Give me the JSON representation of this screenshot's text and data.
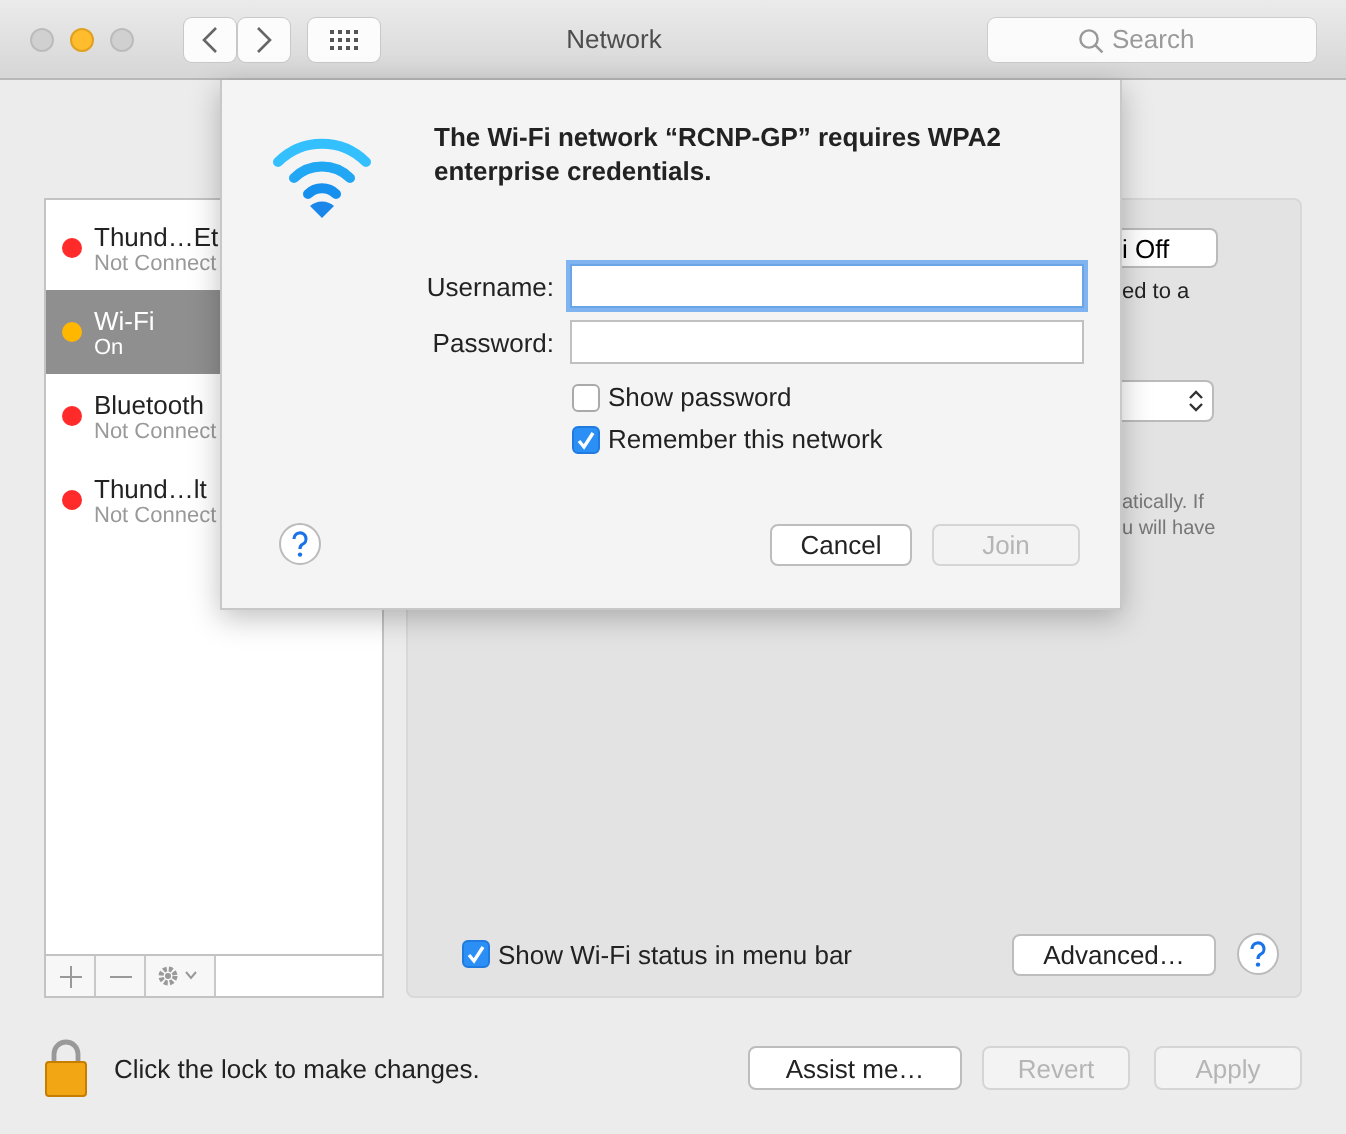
{
  "window": {
    "title": "Network"
  },
  "search": {
    "placeholder": "Search"
  },
  "services": [
    {
      "name": "Thund…Et",
      "status": "Not Connect",
      "color": "#ff2a2a",
      "selected": false
    },
    {
      "name": "Wi-Fi",
      "status": "On",
      "color": "#ffb700",
      "selected": true
    },
    {
      "name": "Bluetooth",
      "status": "Not Connect",
      "color": "#ff2a2a",
      "selected": false
    },
    {
      "name": "Thund…lt",
      "status": "Not Connect",
      "color": "#ff2a2a",
      "selected": false
    }
  ],
  "panel": {
    "wifi_button": "i Off",
    "status_text": "ed to a",
    "note": [
      "atically. If",
      "u will have"
    ],
    "show_status": {
      "label": "Show Wi-Fi status in menu bar",
      "checked": true
    },
    "advanced_button": "Advanced…"
  },
  "footer": {
    "lock_text": "Click the lock to make changes.",
    "buttons": [
      {
        "label": "Assist me…",
        "disabled": false
      },
      {
        "label": "Revert",
        "disabled": true
      },
      {
        "label": "Apply",
        "disabled": true
      }
    ]
  },
  "sheet": {
    "message": "The Wi-Fi network “RCNP-GP” requires WPA2 enterprise credentials.",
    "fields": [
      {
        "label": "Username:",
        "focused": true
      },
      {
        "label": "Password:",
        "focused": false
      }
    ],
    "checkboxes": [
      {
        "label": "Show password",
        "checked": false
      },
      {
        "label": "Remember this network",
        "checked": true
      }
    ],
    "buttons": [
      {
        "label": "Cancel",
        "disabled": false
      },
      {
        "label": "Join",
        "disabled": true
      }
    ]
  }
}
